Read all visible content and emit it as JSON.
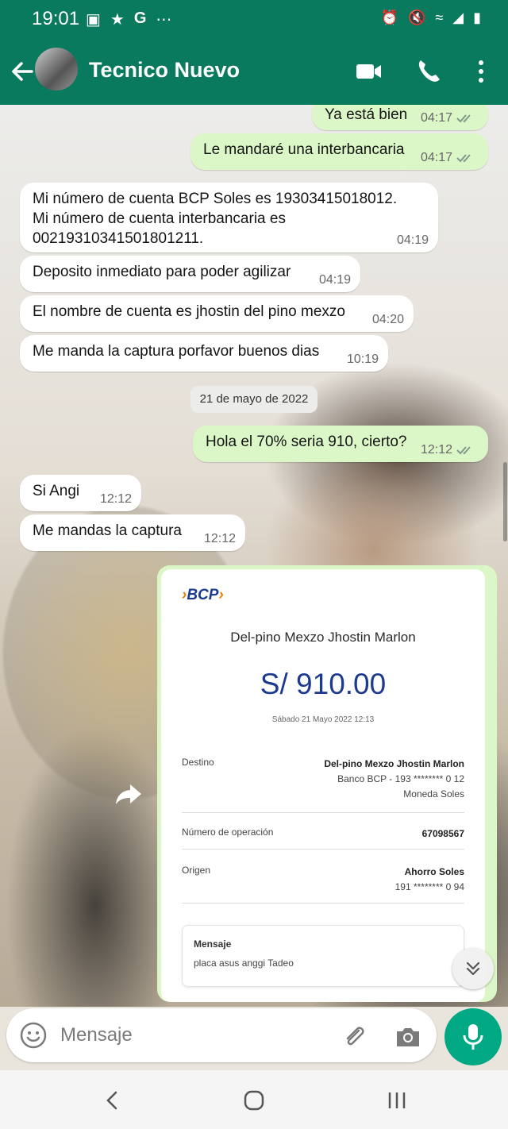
{
  "status_bar": {
    "time": "19:01",
    "left_icons": [
      "image-icon",
      "notification-icon",
      "google-icon",
      "more-dots-icon"
    ],
    "right_icons": [
      "alarm-icon",
      "mute-icon",
      "wifi-icon",
      "signal-icon",
      "battery-icon"
    ]
  },
  "header": {
    "contact_name": "Tecnico Nuevo",
    "colors": {
      "bar": "#0a7a5f",
      "outgoing_bubble": "#dcf7c7",
      "fab": "#00a884"
    }
  },
  "messages": [
    {
      "dir": "out",
      "text": "Ya está bien",
      "time": "04:17",
      "read": true
    },
    {
      "dir": "out",
      "text": "Le mandaré una interbancaria",
      "time": "04:17",
      "read": true
    },
    {
      "dir": "in",
      "text": "Mi número de cuenta BCP Soles es 19303415018012.\nMi número de cuenta interbancaria es\n00219310341501801211.",
      "time": "04:19"
    },
    {
      "dir": "in",
      "text": "Deposito inmediato para poder agilizar",
      "time": "04:19"
    },
    {
      "dir": "in",
      "text": "El nombre de cuenta es jhostin del pino mexzo",
      "time": "04:20"
    },
    {
      "dir": "in",
      "text": "Me manda la captura porfavor buenos dias",
      "time": "10:19"
    },
    {
      "dir": "out",
      "text": "Hola el 70% seria 910, cierto?",
      "time": "12:12",
      "read": true
    },
    {
      "dir": "in",
      "text": "Si Angi",
      "time": "12:12"
    },
    {
      "dir": "in",
      "text": "Me mandas la captura",
      "time": "12:12"
    }
  ],
  "date_chip": "21 de mayo de 2022",
  "receipt": {
    "logo": "BCP",
    "beneficiary": "Del-pino Mexzo Jhostin Marlon",
    "amount": "S/ 910.00",
    "date": "Sábado 21 Mayo 2022 12:13",
    "destino_label": "Destino",
    "destino_name": "Del-pino Mexzo Jhostin Marlon",
    "destino_bank": "Banco BCP - 193 ******** 0 12",
    "destino_currency": "Moneda Soles",
    "operacion_label": "Número de operación",
    "operacion_value": "67098567",
    "origen_label": "Origen",
    "origen_account": "Ahorro Soles",
    "origen_number": "191 ******** 0 94",
    "mensaje_label": "Mensaje",
    "mensaje_value": "placa asus anggi Tadeo"
  },
  "composer": {
    "placeholder": "Mensaje"
  }
}
